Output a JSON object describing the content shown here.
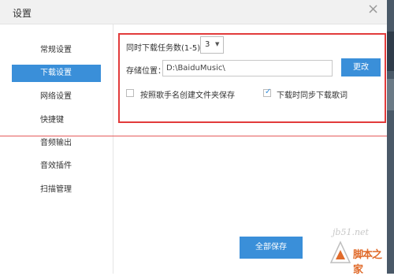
{
  "window": {
    "title": "设置"
  },
  "sidebar": {
    "items": [
      {
        "label": "常规设置",
        "active": false
      },
      {
        "label": "下载设置",
        "active": true
      },
      {
        "label": "网络设置",
        "active": false
      },
      {
        "label": "快捷键",
        "active": false
      },
      {
        "label": "音频输出",
        "active": false
      },
      {
        "label": "音效插件",
        "active": false
      },
      {
        "label": "扫描管理",
        "active": false
      }
    ]
  },
  "download": {
    "concurrent_label": "同时下载任务数(1-5)",
    "concurrent_value": "3",
    "storage_label": "存储位置：",
    "storage_path": "D:\\BaiduMusic\\",
    "change_label": "更改",
    "folder_by_artist_label": "按照歌手名创建文件夹保存",
    "folder_by_artist_checked": false,
    "sync_lyrics_label": "下载时同步下载歌词",
    "sync_lyrics_checked": true
  },
  "footer": {
    "save_all_label": "全部保存"
  },
  "watermark": {
    "url": "jb51.net",
    "text": "脚本之家"
  },
  "colors": {
    "accent": "#3a8fd9",
    "highlight_box": "#e23b3b"
  },
  "icons": {
    "close": "close-icon",
    "dropdown": "chevron-down-icon",
    "check": "checkmark-icon"
  }
}
